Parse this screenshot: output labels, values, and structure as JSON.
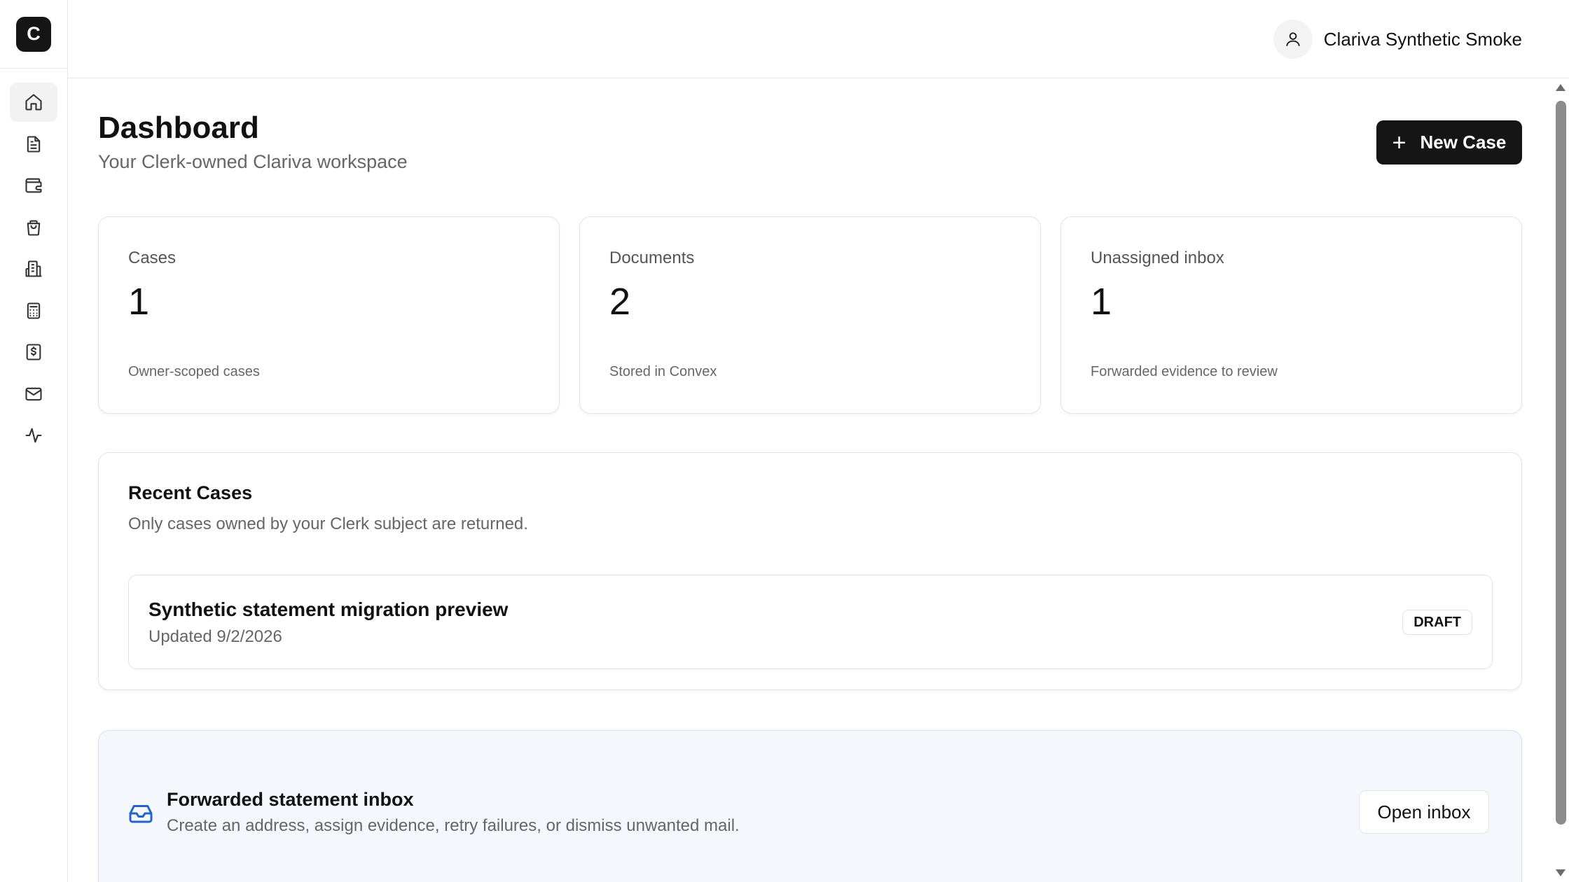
{
  "sidebar": {
    "logo_letter": "C",
    "items": [
      {
        "icon": "home-icon",
        "active": true
      },
      {
        "icon": "file-text-icon",
        "active": false
      },
      {
        "icon": "wallet-icon",
        "active": false
      },
      {
        "icon": "shopping-bag-icon",
        "active": false
      },
      {
        "icon": "building-icon",
        "active": false
      },
      {
        "icon": "calculator-icon",
        "active": false
      },
      {
        "icon": "dollar-receipt-icon",
        "active": false
      },
      {
        "icon": "mail-icon",
        "active": false
      },
      {
        "icon": "activity-icon",
        "active": false
      }
    ]
  },
  "header": {
    "user_icon": "user-icon",
    "user_name": "Clariva Synthetic Smoke"
  },
  "main": {
    "title": "Dashboard",
    "subtitle": "Your Clerk-owned Clariva workspace",
    "new_case_label": "New Case",
    "stats": [
      {
        "label": "Cases",
        "value": "1",
        "note": "Owner-scoped cases"
      },
      {
        "label": "Documents",
        "value": "2",
        "note": "Stored in Convex"
      },
      {
        "label": "Unassigned inbox",
        "value": "1",
        "note": "Forwarded evidence to review"
      }
    ],
    "recent_cases": {
      "title": "Recent Cases",
      "subtitle": "Only cases owned by your Clerk subject are returned.",
      "items": [
        {
          "title": "Synthetic statement migration preview",
          "updated": "Updated 9/2/2026",
          "status": "DRAFT"
        }
      ]
    },
    "inbox_card": {
      "icon": "inbox-icon",
      "title": "Forwarded statement inbox",
      "subtitle": "Create an address, assign evidence, retry failures, or dismiss unwanted mail.",
      "button_label": "Open inbox"
    }
  },
  "colors": {
    "primary": "#151515",
    "accent_blue": "#2563c9",
    "inbox_bg": "#f4f8fc",
    "border": "#e4e4e6"
  }
}
